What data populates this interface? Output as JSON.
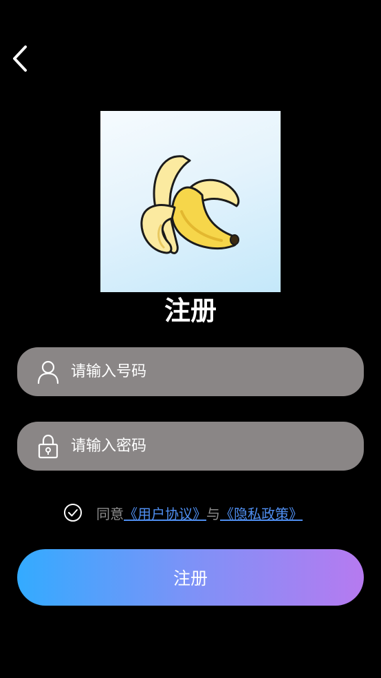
{
  "header": {
    "back_icon": "chevron-left-icon"
  },
  "logo": {
    "icon": "banana-icon",
    "background": "#d7eefb"
  },
  "title": "注册",
  "phone_field": {
    "icon": "user-icon",
    "placeholder": "请输入号码",
    "value": ""
  },
  "password_field": {
    "icon": "lock-icon",
    "placeholder": "请输入密码",
    "value": ""
  },
  "agreement": {
    "check_icon": "check-circle-icon",
    "prefix": "同意",
    "user_agreement": "《用户协议》",
    "conjunction": "与",
    "privacy_policy": "《隐私政策》"
  },
  "submit_button": {
    "label": "注册"
  },
  "colors": {
    "background": "#000000",
    "field_bg": "#8a8686",
    "link": "#4f8ef0",
    "gradient_start": "#33abff",
    "gradient_end": "#b67af0"
  }
}
